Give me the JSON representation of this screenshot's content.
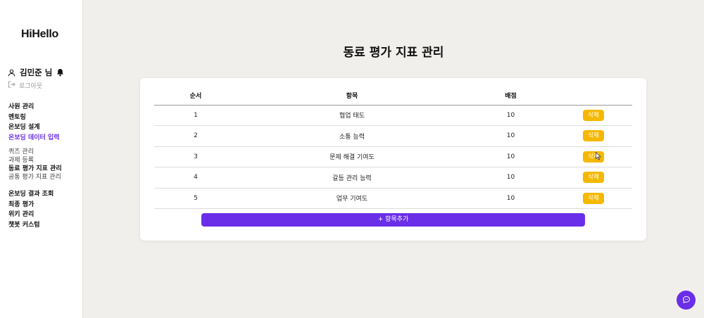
{
  "brand": {
    "logo": "HiHello"
  },
  "user": {
    "name": "김민준 님",
    "logout": "로그아웃"
  },
  "sidebar": {
    "groups": [
      [
        "사원 관리",
        "멘토링",
        "온보딩 설계",
        "온보딩 데이터 입력"
      ],
      [
        "퀴즈 관리",
        "과제 등록",
        "동료 평가 지표 관리",
        "공통 평가 지표 관리"
      ],
      [
        "온보딩 결과 조회",
        "최종 평가",
        "위키 관리",
        "챗봇 커스텀"
      ]
    ]
  },
  "page": {
    "title": "동료 평가 지표 관리"
  },
  "table": {
    "headers": [
      "순서",
      "항목",
      "배점",
      ""
    ],
    "rows": [
      {
        "order": "1",
        "item": "협업 태도",
        "score": "10"
      },
      {
        "order": "2",
        "item": "소통 능력",
        "score": "10"
      },
      {
        "order": "3",
        "item": "문제 해결 기여도",
        "score": "10"
      },
      {
        "order": "4",
        "item": "갈등 관리 능력",
        "score": "10"
      },
      {
        "order": "5",
        "item": "업무 기여도",
        "score": "10"
      }
    ],
    "delete_label": "삭제"
  },
  "add_button": {
    "label": "+ 항목추가"
  },
  "colors": {
    "accent": "#6a2ee8",
    "delete": "#f5b800",
    "background": "#f1efeb"
  },
  "icons": {
    "user": "user-icon",
    "bell": "bell-icon",
    "logout": "logout-icon",
    "chat": "chat-icon"
  }
}
